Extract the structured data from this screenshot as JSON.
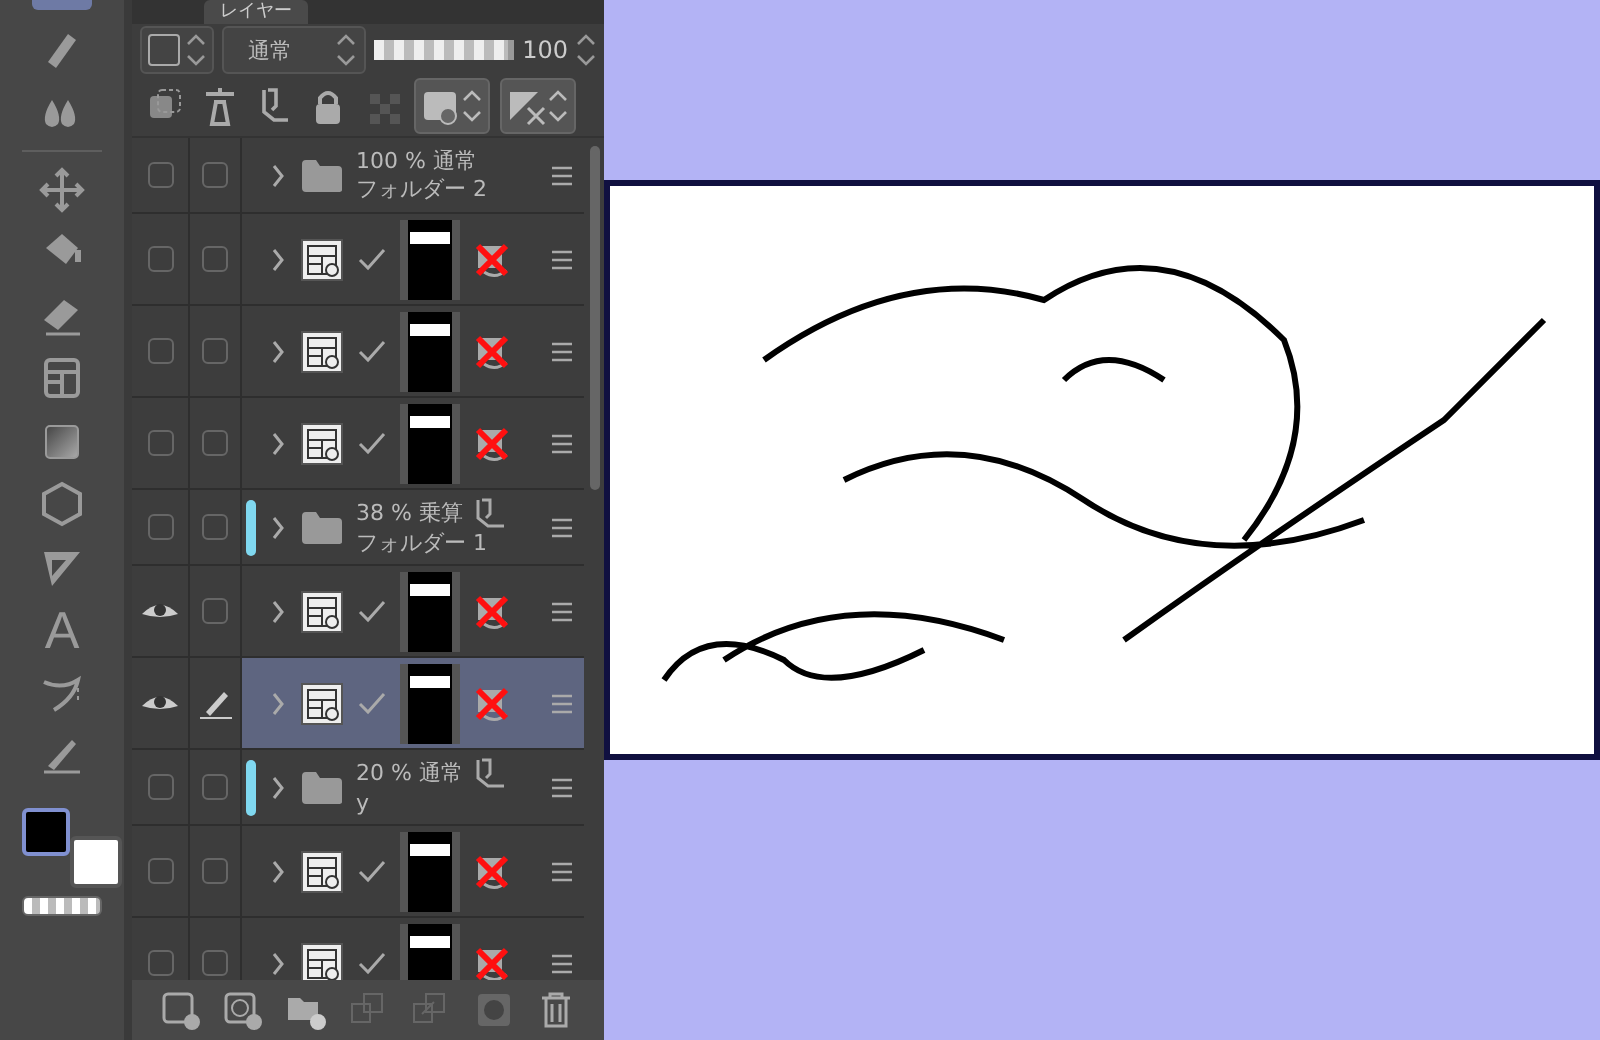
{
  "toolbar": {
    "text_tool_glyph": "A"
  },
  "layer_panel": {
    "tab": "レイヤー",
    "blend_mode": "通常",
    "opacity": {
      "level": 1,
      "value": "100"
    }
  },
  "layers": [
    {
      "kind": "folder",
      "selected": false,
      "visible": false,
      "editing": false,
      "accent": false,
      "clipped": false,
      "info": "100 % 通常",
      "name": "フォルダー 2"
    },
    {
      "kind": "layer",
      "selected": false,
      "visible": false,
      "editing": false
    },
    {
      "kind": "layer",
      "selected": false,
      "visible": false,
      "editing": false
    },
    {
      "kind": "layer",
      "selected": false,
      "visible": false,
      "editing": false
    },
    {
      "kind": "folder",
      "selected": false,
      "visible": false,
      "editing": false,
      "accent": true,
      "clipped": true,
      "info": "38 % 乗算",
      "name": "フォルダー 1"
    },
    {
      "kind": "layer",
      "selected": false,
      "visible": true,
      "editing": false
    },
    {
      "kind": "layer",
      "selected": true,
      "visible": true,
      "editing": true
    },
    {
      "kind": "folder",
      "selected": false,
      "visible": false,
      "editing": false,
      "accent": true,
      "clipped": true,
      "info": "20 % 通常",
      "name": "y"
    },
    {
      "kind": "layer",
      "selected": false,
      "visible": false,
      "editing": false
    },
    {
      "kind": "layer",
      "selected": false,
      "visible": false,
      "editing": false
    }
  ]
}
